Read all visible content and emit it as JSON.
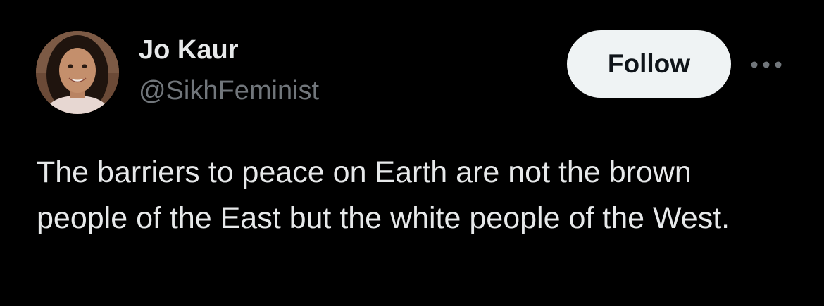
{
  "tweet": {
    "author": {
      "display_name": "Jo Kaur",
      "handle": "@SikhFeminist",
      "avatar_icon": "user-avatar-photo"
    },
    "follow_label": "Follow",
    "more_icon": "more-horizontal-icon",
    "text": "The barriers to peace on Earth are not the brown people of the East but the white people of the West."
  },
  "colors": {
    "background": "#000000",
    "primary_text": "#e7e9ea",
    "secondary_text": "#71767b",
    "follow_button_bg": "#eff3f4",
    "follow_button_text": "#0f1419"
  }
}
